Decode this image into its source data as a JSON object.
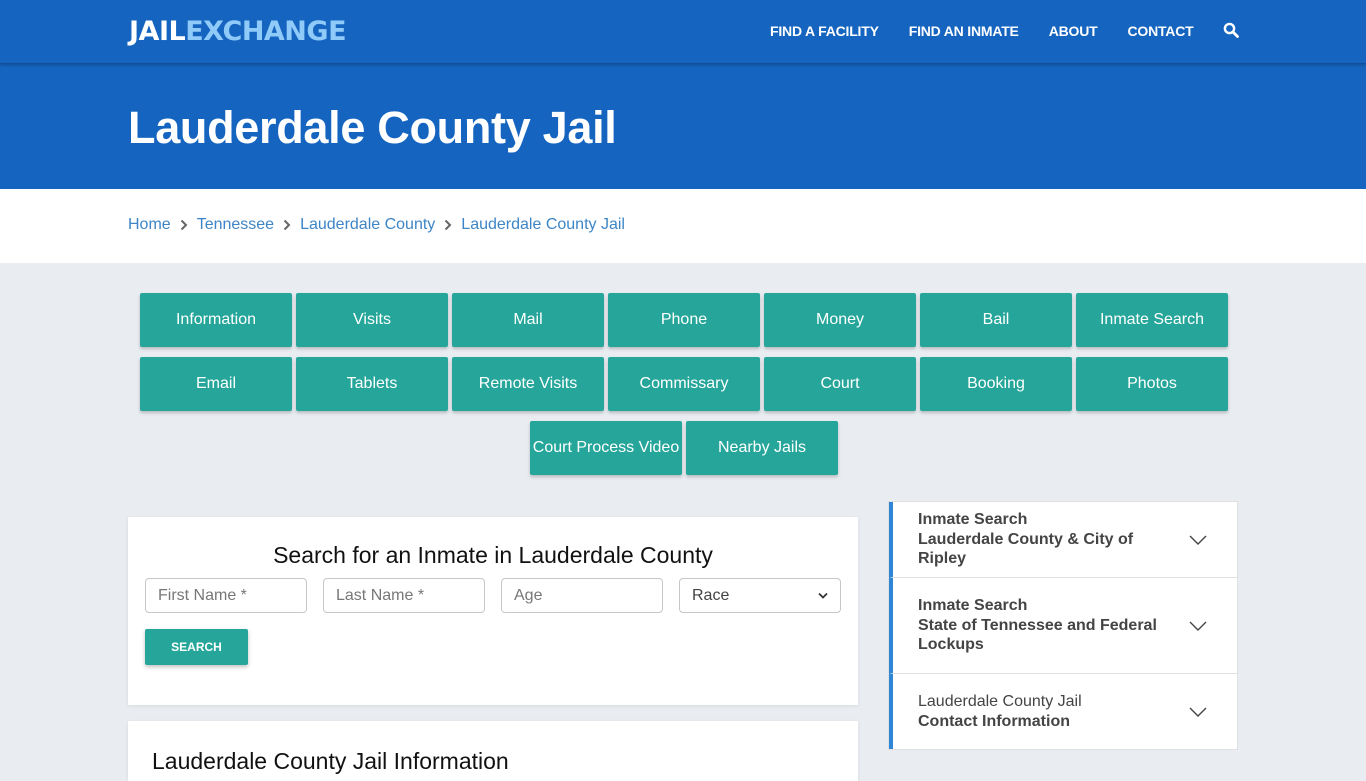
{
  "header": {
    "logo_part1": "JAIL",
    "logo_part2": "EXCHANGE",
    "nav": [
      "FIND A FACILITY",
      "FIND AN INMATE",
      "ABOUT",
      "CONTACT"
    ],
    "search_icon": "search-icon"
  },
  "hero": {
    "title": "Lauderdale County Jail"
  },
  "breadcrumb": [
    "Home",
    "Tennessee",
    "Lauderdale County",
    "Lauderdale County Jail"
  ],
  "tiles": {
    "row1": [
      "Information",
      "Visits",
      "Mail",
      "Phone",
      "Money",
      "Bail",
      "Inmate Search"
    ],
    "row2": [
      "Email",
      "Tablets",
      "Remote Visits",
      "Commissary",
      "Court",
      "Booking",
      "Photos"
    ],
    "row3": [
      "Court Process Video",
      "Nearby Jails"
    ]
  },
  "search_form": {
    "title": "Search for an Inmate in Lauderdale County",
    "first_name_placeholder": "First Name *",
    "last_name_placeholder": "Last Name *",
    "age_placeholder": "Age",
    "race_selected": "Race",
    "button": "SEARCH"
  },
  "info_section": {
    "title": "Lauderdale County Jail Information"
  },
  "accordion": [
    {
      "line1": "Inmate Search",
      "line2": "Lauderdale County & City of Ripley"
    },
    {
      "line1": "Inmate Search",
      "line2": "State of Tennessee and Federal Lockups"
    },
    {
      "line1": "Lauderdale County Jail",
      "line2": "Contact Information"
    }
  ],
  "colors": {
    "brand_blue": "#1565c0",
    "logo_light": "#90caf9",
    "teal": "#26a69a",
    "link_blue": "#3d85c6",
    "accent_border": "#2f86d6"
  }
}
